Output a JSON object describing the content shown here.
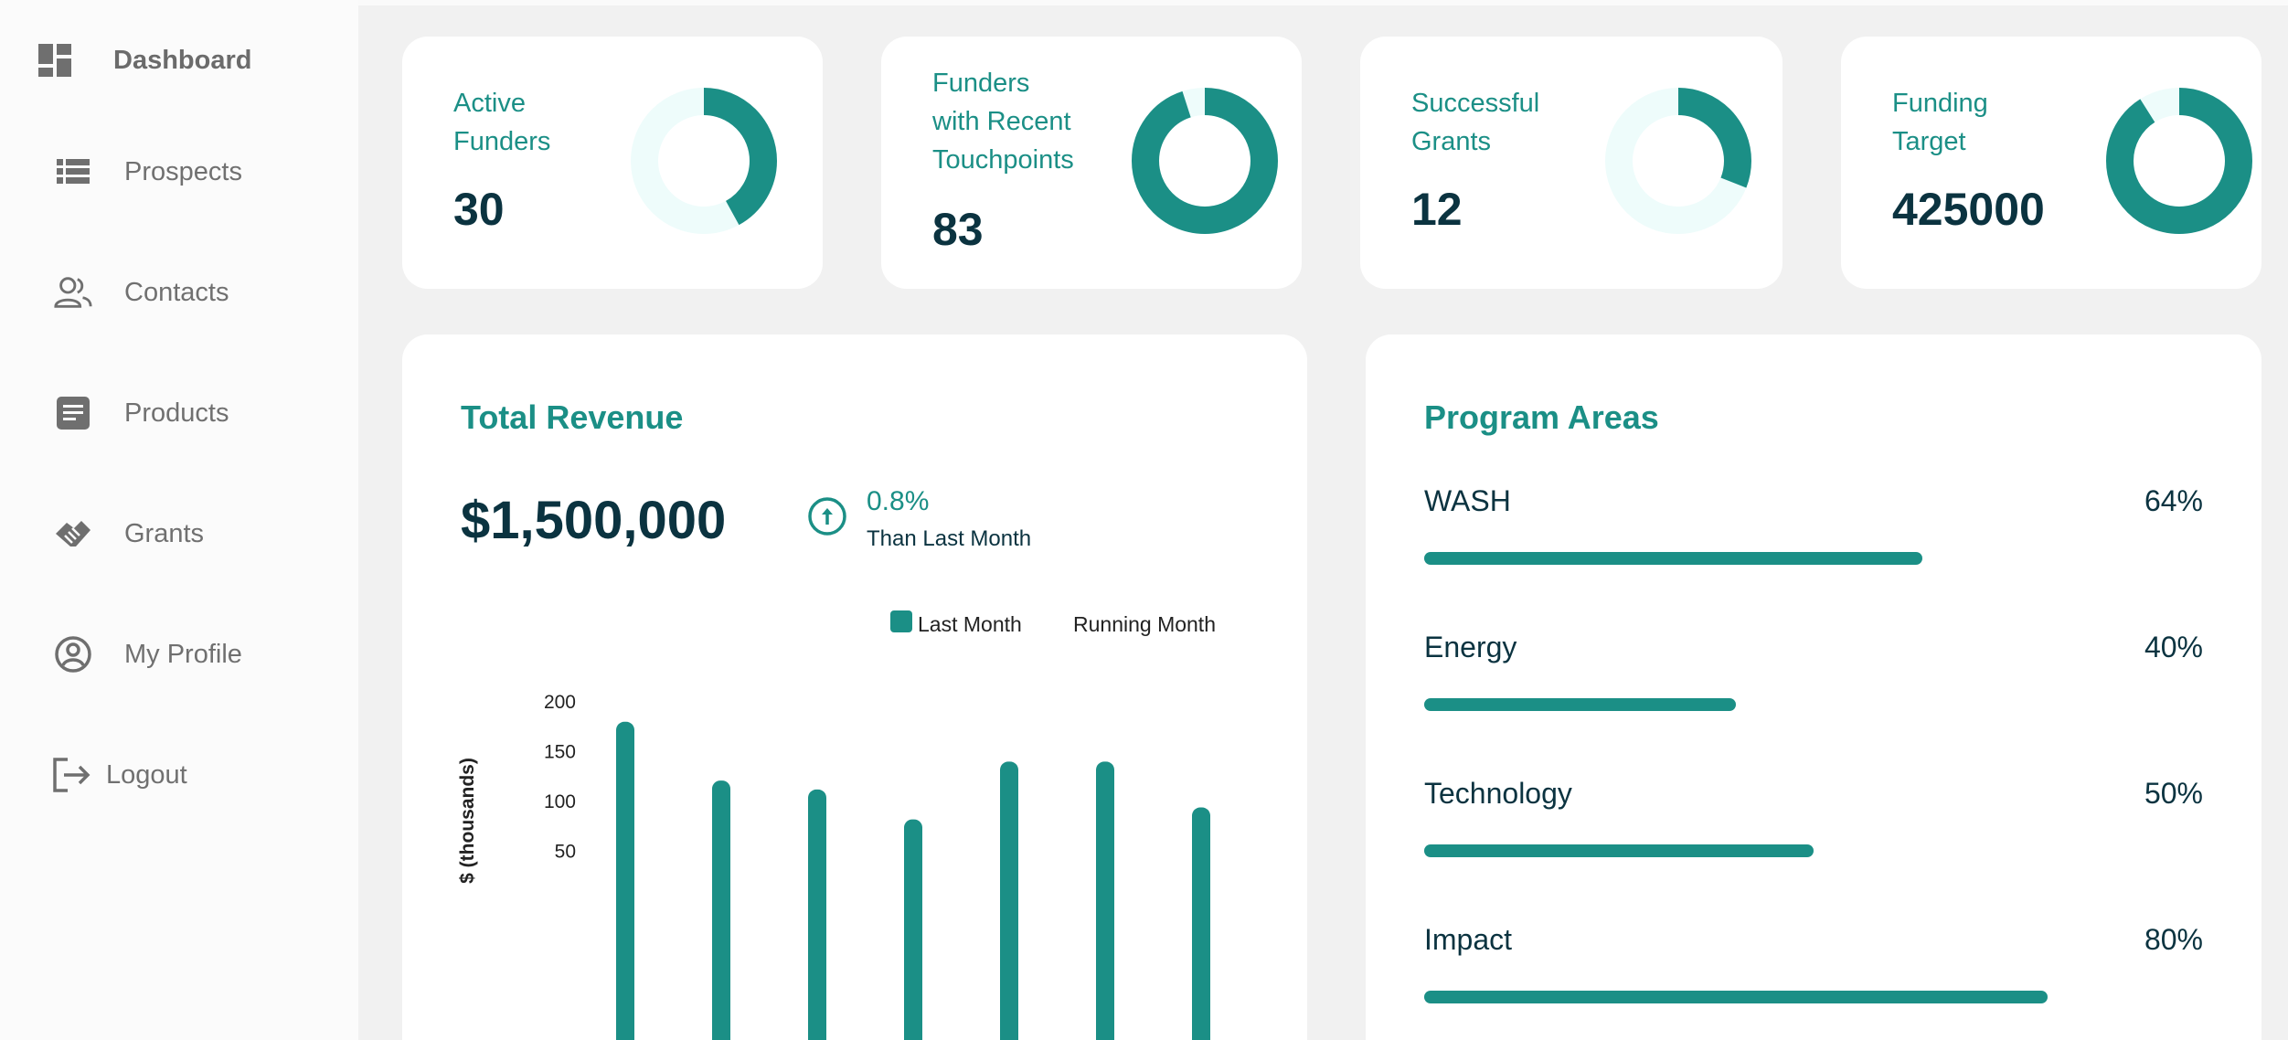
{
  "sidebar": {
    "items": [
      {
        "label": "Dashboard",
        "icon": "dashboard-icon",
        "active": true
      },
      {
        "label": "Prospects",
        "icon": "list-icon",
        "active": false
      },
      {
        "label": "Contacts",
        "icon": "users-icon",
        "active": false
      },
      {
        "label": "Products",
        "icon": "document-icon",
        "active": false
      },
      {
        "label": "Grants",
        "icon": "handshake-icon",
        "active": false
      },
      {
        "label": "My Profile",
        "icon": "profile-icon",
        "active": false
      },
      {
        "label": "Logout",
        "icon": "logout-icon",
        "active": false
      }
    ]
  },
  "stats": [
    {
      "label_lines": [
        "Active",
        "Funders"
      ],
      "value": "30",
      "fraction": 0.42
    },
    {
      "label_lines": [
        "Funders",
        "with Recent",
        "Touchpoints"
      ],
      "value": "83",
      "fraction": 0.95
    },
    {
      "label_lines": [
        "Successful",
        "Grants"
      ],
      "value": "12",
      "fraction": 0.31
    },
    {
      "label_lines": [
        "Funding",
        "Target"
      ],
      "value": "425000",
      "fraction": 0.91
    }
  ],
  "revenue": {
    "title": "Total Revenue",
    "amount": "$1,500,000",
    "change_pct": "0.8%",
    "change_text": "Than Last Month",
    "trend_icon": "arrow-up-circle-icon"
  },
  "chart_data": {
    "type": "bar",
    "ylabel": "$ (thousands)",
    "yticks": [
      "200",
      "150",
      "100",
      "50"
    ],
    "ylim": [
      0,
      200
    ],
    "series": [
      {
        "name": "Last Month",
        "values": [
          180,
          121,
          112,
          82,
          140,
          140,
          94
        ]
      },
      {
        "name": "Running Month",
        "values": []
      }
    ],
    "legend_position": "top-right",
    "grid": false
  },
  "programs": {
    "title": "Program Areas",
    "items": [
      {
        "name": "WASH",
        "pct_label": "64%",
        "value": 0.64
      },
      {
        "name": "Energy",
        "pct_label": "40%",
        "value": 0.4
      },
      {
        "name": "Technology",
        "pct_label": "50%",
        "value": 0.5
      },
      {
        "name": "Impact",
        "pct_label": "80%",
        "value": 0.8
      }
    ]
  },
  "colors": {
    "accent": "#1b8f86",
    "accent_light": "#eefcfb",
    "text_dark": "#0b3340",
    "sidebar_text": "#707070"
  }
}
